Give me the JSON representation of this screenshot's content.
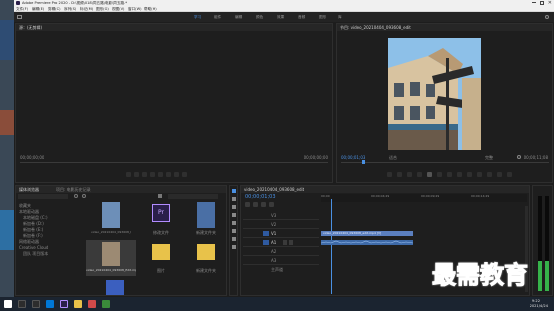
{
  "window": {
    "title": "Adobe Premiere Pro 2020 - D:\\视频\\018\\同五路\\电影\\同五路.*"
  },
  "menu": [
    "文件(F)",
    "编辑(E)",
    "剪辑(C)",
    "序列(S)",
    "标记(M)",
    "图形(G)",
    "视图(V)",
    "窗口(W)",
    "帮助(H)"
  ],
  "workspaces": [
    {
      "label": "学习",
      "active": true
    },
    {
      "label": "组件",
      "active": false
    },
    {
      "label": "编辑",
      "active": false
    },
    {
      "label": "颜色",
      "active": false
    },
    {
      "label": "效果",
      "active": false
    },
    {
      "label": "音频",
      "active": false
    },
    {
      "label": "图形",
      "active": false
    },
    {
      "label": "库",
      "active": false
    }
  ],
  "source_monitor": {
    "tab": "源：(无剪辑)",
    "timecode_in": "00;00;00;00",
    "timecode_out": "00;00;00;00"
  },
  "program_monitor": {
    "tab": "节目: video_20210404_093608_edit",
    "timecode": "00;00;01;03",
    "fit": "适合",
    "quality": "完整",
    "duration": "00;00;11;08"
  },
  "project_panel": {
    "tabs": [
      "媒体浏览器",
      "项目: 电影历史记录"
    ],
    "folders": [
      "收藏夹",
      "本地驱动器",
      "本地磁盘 (C:)",
      "新加卷 (D:)",
      "新加卷 (E:)",
      "新加卷 (F:)",
      "网络驱动器",
      "Creative Cloud",
      "团队 项目版本"
    ],
    "items": [
      {
        "label": "video_20210404_093608_Edit.mp4",
        "kind": "video"
      },
      {
        "label": "修改文件",
        "kind": "pr"
      },
      {
        "label": "新建文件夹",
        "kind": "folder"
      },
      {
        "label": "video_20210404_093608_Edit.mp4",
        "kind": "video"
      },
      {
        "label": "图片",
        "kind": "image"
      },
      {
        "label": "新建文件夹",
        "kind": "folder"
      }
    ]
  },
  "timeline": {
    "tab": "video_20210404_093608_edit",
    "timecode": "00;00;01;03",
    "ruler": [
      "00;00",
      "00;00;04;29",
      "00;00;09;29",
      "00;00;14;29"
    ],
    "tracks": [
      "V3",
      "V2",
      "V1",
      "A1",
      "A2",
      "A3"
    ],
    "clip_label": "video_20210404_093608_edit.mp4 [V]",
    "master": "主声道"
  },
  "watermark": "最需教育",
  "taskbar": {
    "time": "9:22",
    "date": "2021/4/24"
  },
  "colors": {
    "accent": "#4a90e2",
    "clip": "#5b7fbf"
  }
}
